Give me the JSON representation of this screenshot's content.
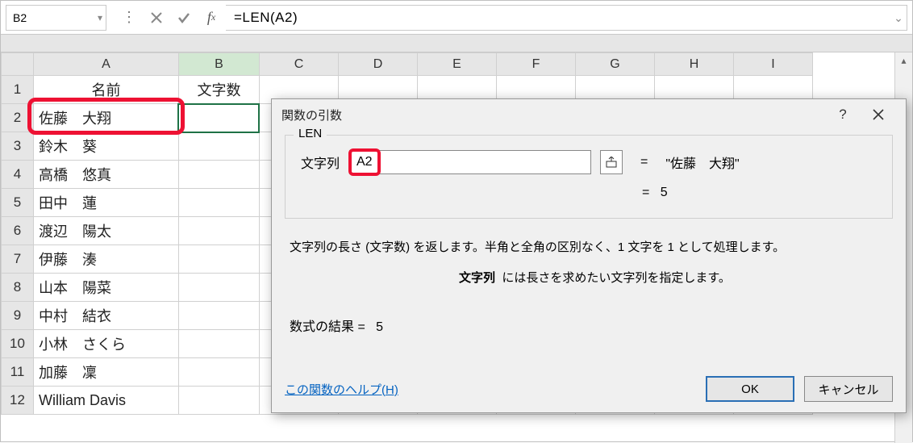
{
  "formula_bar": {
    "name_box": "B2",
    "formula": "=LEN(A2)"
  },
  "columns": [
    "A",
    "B",
    "C",
    "D",
    "E",
    "F",
    "G",
    "H",
    "I"
  ],
  "headers": {
    "A": "名前",
    "B": "文字数"
  },
  "rows": [
    {
      "n": 1
    },
    {
      "n": 2,
      "A": "佐藤　大翔",
      "B": ""
    },
    {
      "n": 3,
      "A": "鈴木　葵"
    },
    {
      "n": 4,
      "A": "高橋　悠真"
    },
    {
      "n": 5,
      "A": "田中　蓮"
    },
    {
      "n": 6,
      "A": "渡辺　陽太"
    },
    {
      "n": 7,
      "A": "伊藤　湊"
    },
    {
      "n": 8,
      "A": "山本　陽菜"
    },
    {
      "n": 9,
      "A": "中村　結衣"
    },
    {
      "n": 10,
      "A": "小林　さくら"
    },
    {
      "n": 11,
      "A": "加藤　凜"
    },
    {
      "n": 12,
      "A": "William Davis"
    }
  ],
  "dialog": {
    "title": "関数の引数",
    "fn": "LEN",
    "arg_label": "文字列",
    "arg_value": "A2",
    "arg_result": "\"佐藤　大翔\"",
    "arg_result2": "5",
    "desc1": "文字列の長さ (文字数) を返します。半角と全角の区別なく、1 文字を 1 として処理します。",
    "desc2_label": "文字列",
    "desc2_text": "には長さを求めたい文字列を指定します。",
    "result_label": "数式の結果 =",
    "result_value": "5",
    "help": "この関数のヘルプ(H)",
    "ok": "OK",
    "cancel": "キャンセル"
  }
}
